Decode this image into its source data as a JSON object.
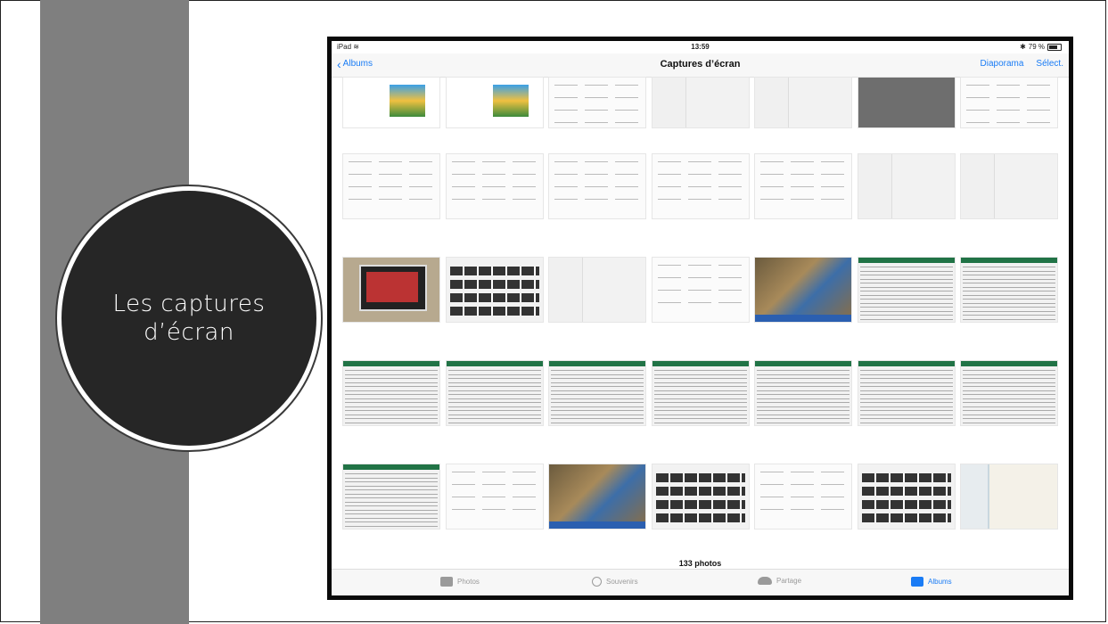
{
  "slide": {
    "title": "Les captures d’écran"
  },
  "status_bar": {
    "device": "iPad",
    "time": "13:59",
    "battery": "79 %"
  },
  "nav": {
    "back_label": "Albums",
    "title": "Captures d’écran",
    "slideshow_label": "Diaporama",
    "select_label": "Sélect."
  },
  "grid": {
    "thumbnails": [
      {
        "kind": "game"
      },
      {
        "kind": "game"
      },
      {
        "kind": "doc"
      },
      {
        "kind": "settings"
      },
      {
        "kind": "settings"
      },
      {
        "kind": "dark"
      },
      {
        "kind": "doc"
      },
      {
        "kind": "doc"
      },
      {
        "kind": "doc"
      },
      {
        "kind": "doc"
      },
      {
        "kind": "doc"
      },
      {
        "kind": "doc"
      },
      {
        "kind": "settings"
      },
      {
        "kind": "settings"
      },
      {
        "kind": "monitor"
      },
      {
        "kind": "contact"
      },
      {
        "kind": "settings"
      },
      {
        "kind": "doc"
      },
      {
        "kind": "photo"
      },
      {
        "kind": "excel"
      },
      {
        "kind": "excel"
      },
      {
        "kind": "excel"
      },
      {
        "kind": "excel"
      },
      {
        "kind": "excel"
      },
      {
        "kind": "excel"
      },
      {
        "kind": "excel"
      },
      {
        "kind": "excel"
      },
      {
        "kind": "excel"
      },
      {
        "kind": "excel"
      },
      {
        "kind": "doc"
      },
      {
        "kind": "photo"
      },
      {
        "kind": "contact"
      },
      {
        "kind": "doc"
      },
      {
        "kind": "contact"
      },
      {
        "kind": "map"
      }
    ]
  },
  "footer": {
    "count": "133 photos"
  },
  "tabs": [
    {
      "label": "Photos",
      "icon": "photos-icon",
      "active": false
    },
    {
      "label": "Souvenirs",
      "icon": "memories-icon",
      "active": false
    },
    {
      "label": "Partage",
      "icon": "cloud-icon",
      "active": false
    },
    {
      "label": "Albums",
      "icon": "albums-icon",
      "active": true
    }
  ],
  "colors": {
    "accent": "#1a7cf5",
    "excel_green": "#217346",
    "circle_fill": "#262626",
    "side_bar": "#7f7f7f"
  }
}
